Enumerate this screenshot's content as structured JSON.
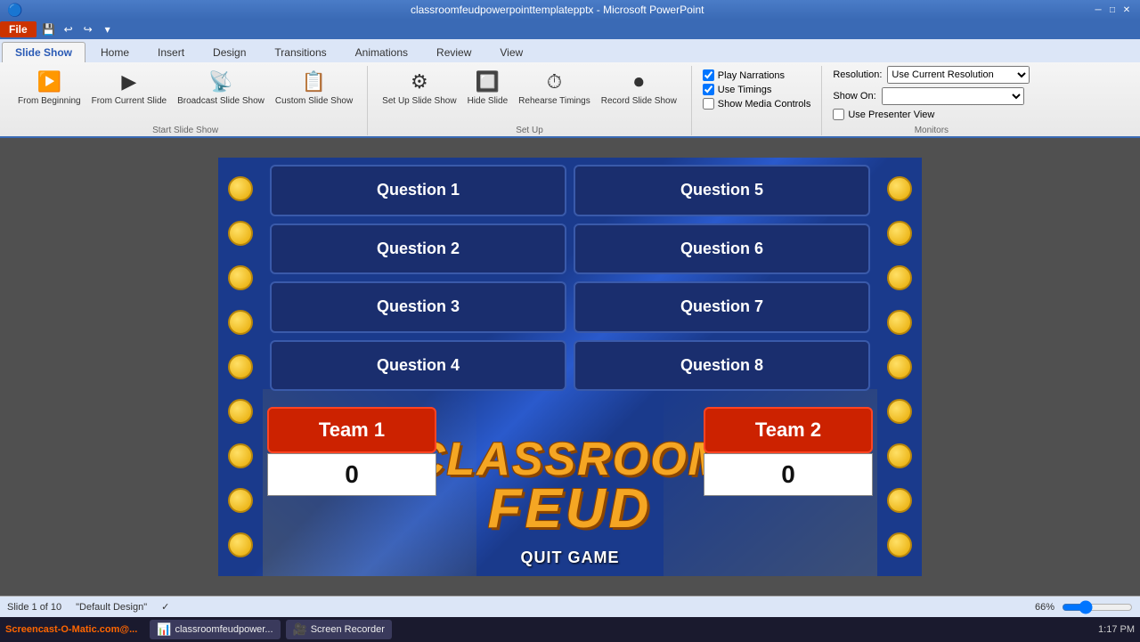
{
  "titlebar": {
    "title": "classroomfeudpowerpointtemplatepptx - Microsoft PowerPoint",
    "minimize": "─",
    "maximize": "□",
    "close": "✕"
  },
  "menubar": {
    "items": [
      "File",
      "Home",
      "Insert",
      "Design",
      "Transitions",
      "Animations",
      "Slide Show",
      "Review",
      "View"
    ]
  },
  "ribbon": {
    "active_tab": "Slide Show",
    "groups": {
      "start_slideshow": {
        "label": "Start Slide Show",
        "buttons": [
          "From Beginning",
          "From Current Slide",
          "Broadcast Slide Show",
          "Custom Slide Show"
        ]
      },
      "setup": {
        "label": "Set Up",
        "buttons": [
          "Set Up Slide Show",
          "Hide Slide",
          "Rehearse Timings",
          "Record Slide Show"
        ]
      },
      "checkboxes": {
        "play_narrations": "Play Narrations",
        "use_timings": "Use Timings",
        "show_media_controls": "Show Media Controls"
      },
      "monitors": {
        "label": "Monitors",
        "resolution_label": "Resolution:",
        "resolution_value": "Use Current Resolution",
        "show_on_label": "Show On:",
        "show_on_value": "",
        "presenter_view": "Use Presenter View"
      }
    }
  },
  "slide": {
    "questions": [
      {
        "id": "q1",
        "label": "Question 1"
      },
      {
        "id": "q2",
        "label": "Question 2"
      },
      {
        "id": "q3",
        "label": "Question 3"
      },
      {
        "id": "q4",
        "label": "Question 4"
      },
      {
        "id": "q5",
        "label": "Question 5"
      },
      {
        "id": "q6",
        "label": "Question 6"
      },
      {
        "id": "q7",
        "label": "Question 7"
      },
      {
        "id": "q8",
        "label": "Question 8"
      }
    ],
    "title_line1": "CLASSROOM",
    "title_line2": "FEUD",
    "team1_name": "Team 1",
    "team2_name": "Team 2",
    "team1_score": "0",
    "team2_score": "0",
    "quit_button": "QUIT GAME"
  },
  "statusbar": {
    "slide_info": "Slide 1 of 10",
    "theme": "\"Default Design\"",
    "zoom": "66%"
  },
  "taskbar": {
    "brand": "Screencast-O-Matic.com@...",
    "items": [
      {
        "label": "classroomfeudpower...",
        "icon": "📊"
      },
      {
        "label": "Screen Recorder",
        "icon": "🎥"
      }
    ],
    "time": "1:17 PM"
  }
}
